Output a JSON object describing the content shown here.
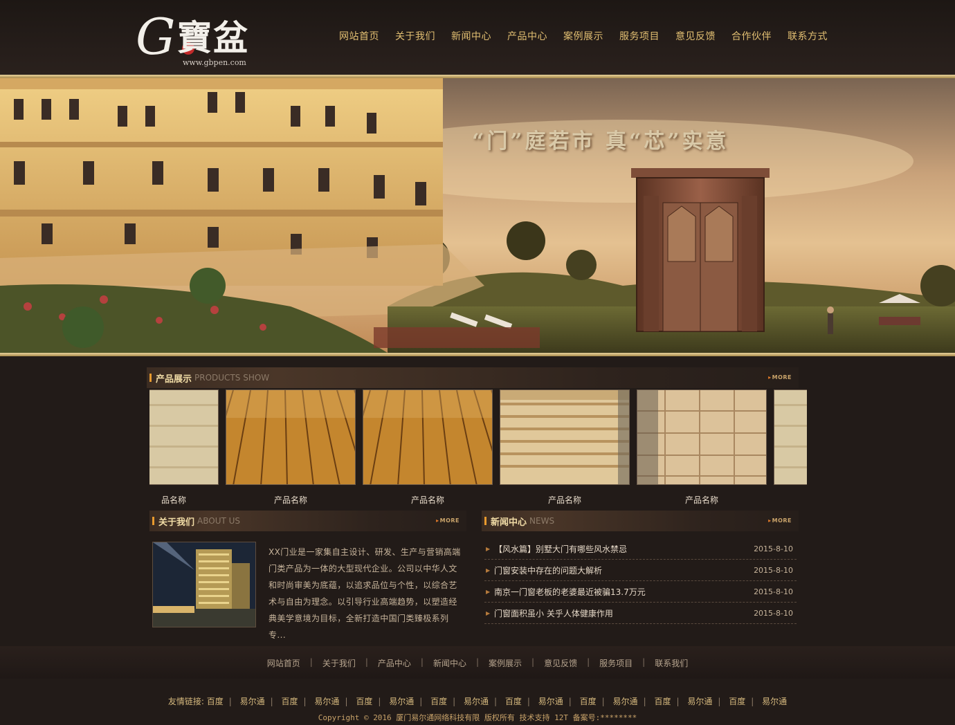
{
  "header": {
    "logo_text": "G寶盆",
    "logo_url": "www.gbpen.com",
    "nav": [
      "网站首页",
      "关于我们",
      "新闻中心",
      "产品中心",
      "案例展示",
      "服务项目",
      "意见反馈",
      "合作伙伴",
      "联系方式"
    ]
  },
  "banner": {
    "slogan": "“门”庭若市 真“芯”实意"
  },
  "products": {
    "title": "产品展示",
    "subtitle": "PRODUCTS SHOW",
    "more": "MORE",
    "partial_left_name": "品名称",
    "items": [
      {
        "name": "产品名称",
        "image": "wood-floor"
      },
      {
        "name": "产品名称",
        "image": "wood-floor"
      },
      {
        "name": "产品名称",
        "image": "lumber-stack"
      },
      {
        "name": "产品名称",
        "image": "lumber-ends"
      }
    ]
  },
  "about": {
    "title": "关于我们",
    "subtitle": "ABOUT US",
    "more": "MORE",
    "text": "XX门业是一家集自主设计、研发、生产与营销高端门类产品为一体的大型现代企业。公司以中华人文和时尚审美为底蕴，以追求品位与个性，以综合艺术与自由为理念。以引导行业高端趋势，以塑造经典美学意境为目标，全新打造中国门类臻极系列专..."
  },
  "news": {
    "title": "新闻中心",
    "subtitle": "NEWS",
    "more": "MORE",
    "items": [
      {
        "title": "【风水篇】别墅大门有哪些风水禁忌",
        "date": "2015-8-10"
      },
      {
        "title": "门窗安装中存在的问题大解析",
        "date": "2015-8-10"
      },
      {
        "title": "南京一门窗老板的老婆最近被骗13.7万元",
        "date": "2015-8-10"
      },
      {
        "title": "门窗面积虽小 关乎人体健康作用",
        "date": "2015-8-10"
      }
    ]
  },
  "footer": {
    "nav": [
      "网站首页",
      "关于我们",
      "产品中心",
      "新闻中心",
      "案例展示",
      "意见反馈",
      "服务项目",
      "联系我们"
    ],
    "separator": "|",
    "friend_label": "友情链接:",
    "friend_links": [
      "百度",
      "易尔通",
      "百度",
      "易尔通",
      "百度",
      "易尔通",
      "百度",
      "易尔通",
      "百度",
      "易尔通",
      "百度",
      "易尔通",
      "百度",
      "易尔通",
      "百度",
      "易尔通"
    ],
    "copyright": "Copyright © 2016 厦门易尔通网络科技有限 版权所有 技术支持 12T 备案号:********"
  },
  "colors": {
    "accent_gold": "#e2bf72",
    "background": "#221b18",
    "section_mark": "#e89a2e"
  }
}
